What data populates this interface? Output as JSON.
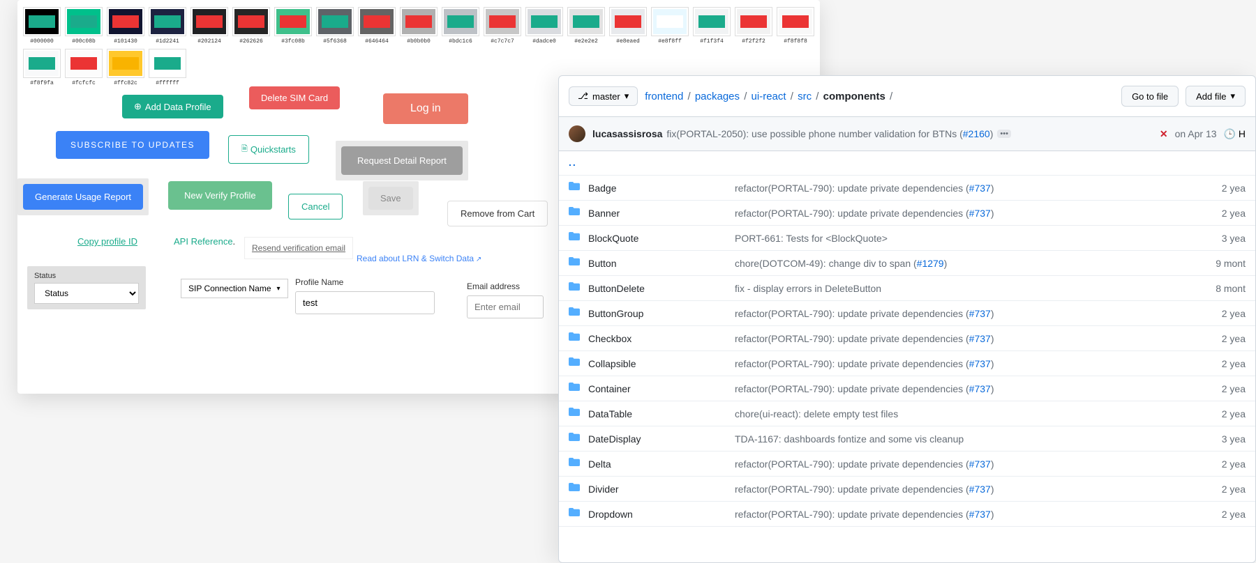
{
  "swatches": [
    {
      "bg": "#000000",
      "fg": "#1aab8b",
      "label": "#000000"
    },
    {
      "bg": "#00c08b",
      "fg": "#1aab8b",
      "label": "#00c08b"
    },
    {
      "bg": "#101430",
      "fg": "#eb3434",
      "label": "#101430"
    },
    {
      "bg": "#1d2241",
      "fg": "#1aab8b",
      "label": "#1d2241"
    },
    {
      "bg": "#202124",
      "fg": "#eb3434",
      "label": "#202124"
    },
    {
      "bg": "#262626",
      "fg": "#eb3434",
      "label": "#262626"
    },
    {
      "bg": "#3fc08b",
      "fg": "#eb3434",
      "label": "#3fc08b"
    },
    {
      "bg": "#5f6368",
      "fg": "#1aab8b",
      "label": "#5f6368"
    },
    {
      "bg": "#646464",
      "fg": "#eb3434",
      "label": "#646464"
    },
    {
      "bg": "#b0b0b0",
      "fg": "#eb3434",
      "label": "#b0b0b0"
    },
    {
      "bg": "#bdc1c6",
      "fg": "#1aab8b",
      "label": "#bdc1c6"
    },
    {
      "bg": "#c7c7c7",
      "fg": "#eb3434",
      "label": "#c7c7c7"
    },
    {
      "bg": "#dadce0",
      "fg": "#1aab8b",
      "label": "#dadce0"
    },
    {
      "bg": "#e2e2e2",
      "fg": "#1aab8b",
      "label": "#e2e2e2"
    },
    {
      "bg": "#e8eaed",
      "fg": "#eb3434",
      "label": "#e8eaed"
    },
    {
      "bg": "#e8f8ff",
      "fg": "#ffffff",
      "label": "#e8f8ff"
    },
    {
      "bg": "#f1f3f4",
      "fg": "#1aab8b",
      "label": "#f1f3f4"
    },
    {
      "bg": "#f2f2f2",
      "fg": "#eb3434",
      "label": "#f2f2f2"
    },
    {
      "bg": "#f8f8f8",
      "fg": "#eb3434",
      "label": "#f8f8f8"
    },
    {
      "bg": "#f8f9fa",
      "fg": "#1aab8b",
      "label": "#f8f9fa"
    },
    {
      "bg": "#fcfcfc",
      "fg": "#eb3434",
      "label": "#fcfcfc"
    },
    {
      "bg": "#ffc82c",
      "fg": "#f9b300",
      "label": "#ffc82c"
    },
    {
      "bg": "#ffffff",
      "fg": "#1aab8b",
      "label": "#ffffff"
    }
  ],
  "buttons": {
    "add_data_profile": "Add Data Profile",
    "delete_sim": "Delete SIM Card",
    "login": "Log in",
    "subscribe": "SUBSCRIBE TO UPDATES",
    "quickstarts": "Quickstarts",
    "request_detail": "Request Detail Report",
    "generate_usage": "Generate Usage Report",
    "new_verify": "New Verify Profile",
    "cancel": "Cancel",
    "save": "Save",
    "remove_cart": "Remove from Cart"
  },
  "links": {
    "copy_profile": "Copy profile ID",
    "api_ref": "API Reference",
    "resend": "Resend verification email",
    "lrn": "Read about LRN & Switch Data"
  },
  "form": {
    "status_label": "Status",
    "status_placeholder": "Status",
    "sip_label": "SIP Connection Name",
    "profile_label": "Profile Name",
    "profile_value": "test",
    "email_label": "Email address",
    "email_placeholder": "Enter email"
  },
  "repo": {
    "branch": "master",
    "breadcrumb": [
      "frontend",
      "packages",
      "ui-react",
      "src",
      "components"
    ],
    "goto": "Go to file",
    "addfile": "Add file",
    "author": "lucasassisrosa",
    "commit_msg": "fix(PORTAL-2050): use possible phone number validation for BTNs (",
    "commit_pr": "#2160",
    "commit_close": ")",
    "date": "on Apr 13",
    "history_label": "H",
    "parent": "..",
    "files": [
      {
        "name": "Badge",
        "msg": "refactor(PORTAL-790): update private dependencies (",
        "pr": "#737",
        "close": ")",
        "time": "2 yea"
      },
      {
        "name": "Banner",
        "msg": "refactor(PORTAL-790): update private dependencies (",
        "pr": "#737",
        "close": ")",
        "time": "2 yea"
      },
      {
        "name": "BlockQuote",
        "msg": "PORT-661: Tests for <BlockQuote>",
        "pr": "",
        "close": "",
        "time": "3 yea"
      },
      {
        "name": "Button",
        "msg": "chore(DOTCOM-49): change div to span (",
        "pr": "#1279",
        "close": ")",
        "time": "9 mont"
      },
      {
        "name": "ButtonDelete",
        "msg": "fix - display errors in DeleteButton",
        "pr": "",
        "close": "",
        "time": "8 mont"
      },
      {
        "name": "ButtonGroup",
        "msg": "refactor(PORTAL-790): update private dependencies (",
        "pr": "#737",
        "close": ")",
        "time": "2 yea"
      },
      {
        "name": "Checkbox",
        "msg": "refactor(PORTAL-790): update private dependencies (",
        "pr": "#737",
        "close": ")",
        "time": "2 yea"
      },
      {
        "name": "Collapsible",
        "msg": "refactor(PORTAL-790): update private dependencies (",
        "pr": "#737",
        "close": ")",
        "time": "2 yea"
      },
      {
        "name": "Container",
        "msg": "refactor(PORTAL-790): update private dependencies (",
        "pr": "#737",
        "close": ")",
        "time": "2 yea"
      },
      {
        "name": "DataTable",
        "msg": "chore(ui-react): delete empty test files",
        "pr": "",
        "close": "",
        "time": "2 yea"
      },
      {
        "name": "DateDisplay",
        "msg": "TDA-1167: dashboards fontize and some vis cleanup",
        "pr": "",
        "close": "",
        "time": "3 yea"
      },
      {
        "name": "Delta",
        "msg": "refactor(PORTAL-790): update private dependencies (",
        "pr": "#737",
        "close": ")",
        "time": "2 yea"
      },
      {
        "name": "Divider",
        "msg": "refactor(PORTAL-790): update private dependencies (",
        "pr": "#737",
        "close": ")",
        "time": "2 yea"
      },
      {
        "name": "Dropdown",
        "msg": "refactor(PORTAL-790): update private dependencies (",
        "pr": "#737",
        "close": ")",
        "time": "2 yea"
      }
    ]
  }
}
